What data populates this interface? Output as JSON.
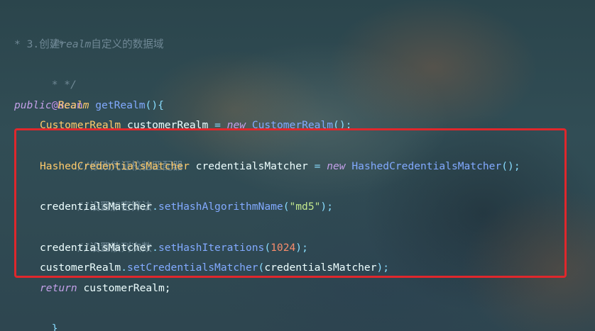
{
  "colors": {
    "highlight_border": "#e0272c",
    "comment": "#6f8895",
    "keyword": "#c3a0e8",
    "type": "#ffcb6b",
    "method": "#82aaff",
    "string": "#c3e88d",
    "number": "#f78c6c",
    "annotation": "#c791ea"
  },
  "lines": {
    "l1": {
      "text": "/*"
    },
    "l2": {
      "prefix": "* 3.创建",
      "italic": "realm",
      "suffix": "自定义的数据域"
    },
    "l3": {
      "text": "* */"
    },
    "l4": {
      "text": "@Bean"
    },
    "l5": {
      "kw": "public",
      "type": "Realm",
      "method": "getRealm",
      "paren": "(){"
    },
    "l6": {
      "class": "CustomerRealm",
      "var": "customerRealm",
      "eq": "=",
      "kw": "new",
      "ctor": "CustomerRealm",
      "end": "();"
    },
    "l7": {
      "text": "//修改凭证校验匹配器"
    },
    "l8": {
      "class": "HashedCredentialsMatcher",
      "var": "credentialsMatcher",
      "eq": "=",
      "kw": "new",
      "ctor": "HashedCredentialsMatcher",
      "end": "();"
    },
    "l9": {
      "text": "//设置加密算法"
    },
    "l10": {
      "obj": "credentialsMatcher",
      "dot": ".",
      "method": "setHashAlgorithmName",
      "open": "(",
      "arg": "\"md5\"",
      "close": ");"
    },
    "l11": {
      "text": "//设置散列次数"
    },
    "l12": {
      "obj": "credentialsMatcher",
      "dot": ".",
      "method": "setHashIterations",
      "open": "(",
      "arg": "1024",
      "close": ");"
    },
    "l13": {
      "obj": "customerRealm",
      "dot": ".",
      "method": "setCredentialsMatcher",
      "open": "(",
      "arg": "credentialsMatcher",
      "close": ");"
    },
    "l14": {
      "kw": "return",
      "var": "customerRealm",
      "end": ";"
    },
    "l15": {
      "text": "}"
    }
  }
}
